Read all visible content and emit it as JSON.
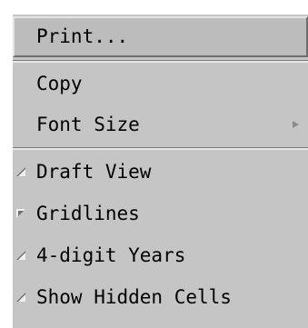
{
  "menu": {
    "items": [
      {
        "label": "Print...",
        "state": "highlighted"
      },
      {
        "label": "Copy"
      },
      {
        "label": "Font Size",
        "has_submenu": true
      },
      {
        "label": "Draft View",
        "checked": false
      },
      {
        "label": "Gridlines",
        "checked": true
      },
      {
        "label": "4-digit Years",
        "checked": false
      },
      {
        "label": "Show Hidden Cells",
        "checked": false
      }
    ]
  },
  "colors": {
    "menu_background": "#c5c5c5",
    "text": "#000000",
    "bevel_light": "#e4e4e4",
    "bevel_dark": "#6e6e6e"
  }
}
